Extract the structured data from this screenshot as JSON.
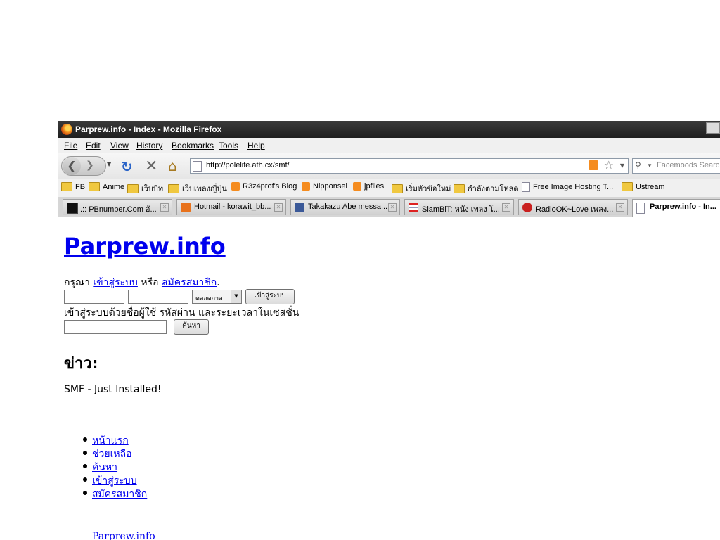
{
  "window": {
    "title": "Parprew.info - Index - Mozilla Firefox"
  },
  "menu": [
    "File",
    "Edit",
    "View",
    "History",
    "Bookmarks",
    "Tools",
    "Help"
  ],
  "navbar": {
    "url": "http://polelife.ath.cx/smf/",
    "search_placeholder": "Facemoods Search"
  },
  "bookmarks": [
    {
      "label": "FB",
      "icon": "folder-icon"
    },
    {
      "label": "Anime",
      "icon": "folder-icon"
    },
    {
      "label": "เว็บบิท",
      "icon": "folder-icon"
    },
    {
      "label": "เว็บเพลงญี่ปุ่น",
      "icon": "folder-icon"
    },
    {
      "label": "R3z4prof's Blog",
      "icon": "rss-icon"
    },
    {
      "label": "Nipponsei",
      "icon": "rss-icon"
    },
    {
      "label": "jpfiles",
      "icon": "rss-icon"
    },
    {
      "label": "เริ่มหัวข้อใหม่",
      "icon": "folder-icon"
    },
    {
      "label": "กำลังตามโหลด",
      "icon": "folder-icon"
    },
    {
      "label": "Free Image Hosting T...",
      "icon": "page-icon"
    },
    {
      "label": "Ustream",
      "icon": "folder-icon"
    }
  ],
  "tabs": [
    {
      "label": ".:: PBnumber.Com อั...",
      "active": false
    },
    {
      "label": "Hotmail - korawit_bb...",
      "active": false
    },
    {
      "label": "Takakazu Abe messa...",
      "active": false
    },
    {
      "label": "SiamBiT: หนัง เพลง โ...",
      "active": false
    },
    {
      "label": "RadioOK~Love เพลง...",
      "active": false
    },
    {
      "label": "Parprew.info - In...",
      "active": true
    }
  ],
  "page": {
    "site_title": "Parprew.info",
    "login": {
      "prompt_prefix": "กรุณา",
      "login_link": "เข้าสู่ระบบ",
      "or_text": "หรือ",
      "register_link": "สมัครสมาชิก",
      "period": ".",
      "duration_selected": "ตลอดกาล",
      "login_button": "เข้าสู่ระบบ",
      "hint": "เข้าสู่ระบบด้วยชื่อผู้ใช้ รหัสผ่าน และระยะเวลาในเซสชั่น",
      "search_button": "ค้นหา"
    },
    "news_heading": "ข่าว:",
    "news_text": "SMF - Just Installed!",
    "nav": [
      "หน้าแรก",
      "ช่วยเหลือ",
      "ค้นหา",
      "เข้าสู่ระบบ",
      "สมัครสมาชิก"
    ],
    "footer_link": "Parprew.info"
  }
}
